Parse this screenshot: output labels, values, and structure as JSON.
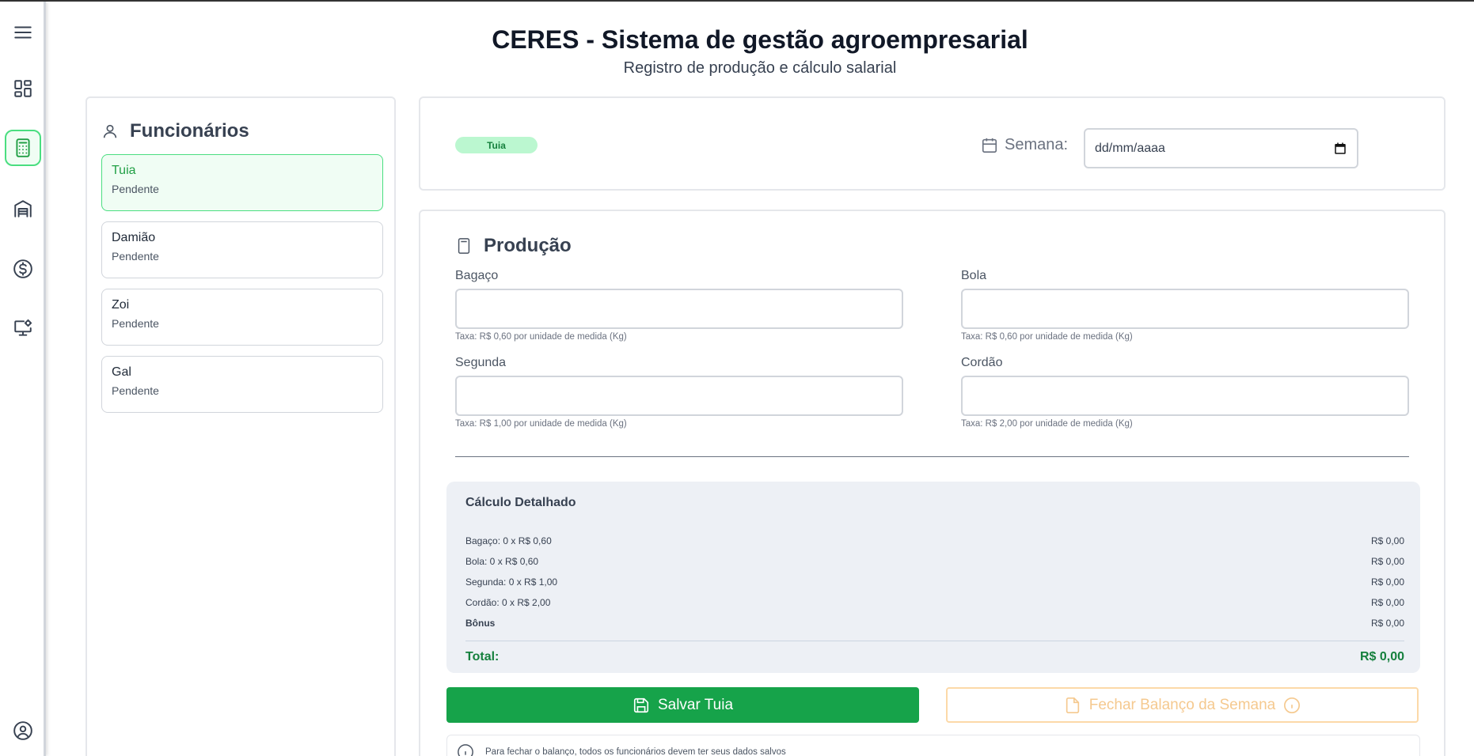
{
  "header": {
    "title": "CERES - Sistema de gestão agroempresarial",
    "subtitle": "Registro de produção e cálculo salarial"
  },
  "sidebar": {
    "items": [
      {
        "icon": "menu-icon"
      },
      {
        "icon": "dashboard-icon"
      },
      {
        "icon": "calculator-icon",
        "active": true
      },
      {
        "icon": "warehouse-icon"
      },
      {
        "icon": "dollar-icon"
      },
      {
        "icon": "monitor-settings-icon"
      },
      {
        "icon": "user-circle-icon"
      }
    ]
  },
  "employees": {
    "title": "Funcionários",
    "list": [
      {
        "name": "Tuia",
        "status": "Pendente",
        "selected": true
      },
      {
        "name": "Damião",
        "status": "Pendente"
      },
      {
        "name": "Zoi",
        "status": "Pendente"
      },
      {
        "name": "Gal",
        "status": "Pendente"
      }
    ]
  },
  "top": {
    "badge": "Tuia",
    "week_label": "Semana:",
    "date_placeholder": "dd/mm/aaaa"
  },
  "production": {
    "title": "Produção",
    "fields": [
      {
        "label": "Bagaço",
        "hint": "Taxa: R$ 0,60 por unidade de medida (Kg)"
      },
      {
        "label": "Bola",
        "hint": "Taxa: R$ 0,60 por unidade de medida (Kg)"
      },
      {
        "label": "Segunda",
        "hint": "Taxa: R$ 1,00 por unidade de medida (Kg)"
      },
      {
        "label": "Cordão",
        "hint": "Taxa: R$ 2,00 por unidade de medida (Kg)"
      }
    ]
  },
  "calculation": {
    "title": "Cálculo Detalhado",
    "rows": [
      {
        "label": "Bagaço: 0 x R$ 0,60",
        "value": "R$ 0,00"
      },
      {
        "label": "Bola: 0 x R$ 0,60",
        "value": "R$ 0,00"
      },
      {
        "label": "Segunda: 0 x R$ 1,00",
        "value": "R$ 0,00"
      },
      {
        "label": "Cordão: 0 x R$ 2,00",
        "value": "R$ 0,00"
      },
      {
        "label": "Bônus",
        "value": "R$ 0,00"
      }
    ],
    "total_label": "Total:",
    "total_value": "R$ 0,00"
  },
  "actions": {
    "save_label": "Salvar Tuia",
    "close_label": "Fechar Balanço da Semana",
    "info_text": "Para fechar o balanço, todos os funcionários devem ter seus dados salvos"
  },
  "colors": {
    "accent": "#16a34a",
    "warning": "#f5c98f",
    "panel_bg": "#edf0f5"
  }
}
